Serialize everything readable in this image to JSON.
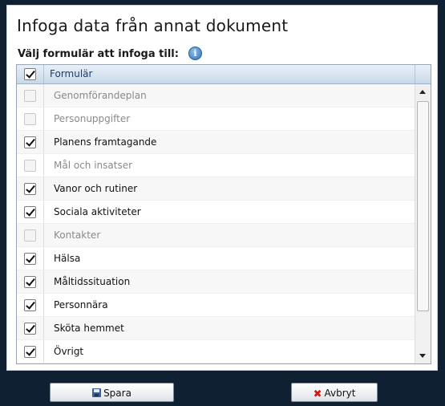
{
  "dialog": {
    "title": "Infoga data från annat dokument",
    "subtitle": "Välj formulär att infoga till:",
    "info_icon": "info-icon",
    "info_glyph": "i"
  },
  "grid": {
    "header": {
      "label": "Formulär",
      "all_checked": true
    },
    "rows": [
      {
        "label": "Genomförandeplan",
        "checked": false,
        "disabled": true
      },
      {
        "label": "Personuppgifter",
        "checked": false,
        "disabled": true
      },
      {
        "label": "Planens framtagande",
        "checked": true,
        "disabled": false
      },
      {
        "label": "Mål och insatser",
        "checked": false,
        "disabled": true
      },
      {
        "label": "Vanor och rutiner",
        "checked": true,
        "disabled": false
      },
      {
        "label": "Sociala aktiviteter",
        "checked": true,
        "disabled": false
      },
      {
        "label": "Kontakter",
        "checked": false,
        "disabled": true
      },
      {
        "label": "Hälsa",
        "checked": true,
        "disabled": false
      },
      {
        "label": "Måltidssituation",
        "checked": true,
        "disabled": false
      },
      {
        "label": "Personnära",
        "checked": true,
        "disabled": false
      },
      {
        "label": "Sköta hemmet",
        "checked": true,
        "disabled": false
      },
      {
        "label": "Övrigt",
        "checked": true,
        "disabled": false
      }
    ]
  },
  "buttons": {
    "save_label": "Spara",
    "save_icon": "floppy-disk-icon",
    "cancel_label": "Avbryt",
    "cancel_icon": "close-icon",
    "cancel_glyph": "✖"
  },
  "colors": {
    "header_text": "#1d3c6b",
    "cancel_icon": "#d11a1a",
    "backdrop": "#0f2033"
  }
}
